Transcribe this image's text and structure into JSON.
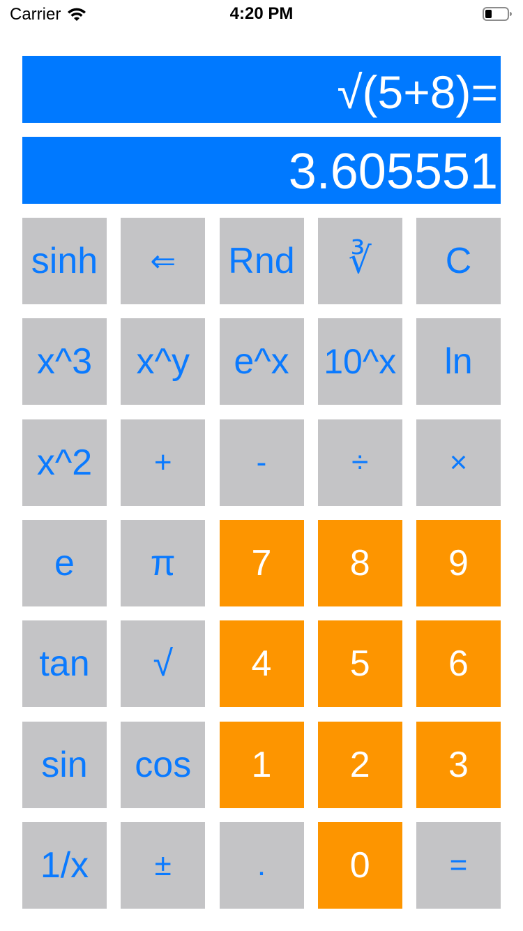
{
  "status_bar": {
    "carrier": "Carrier",
    "time": "4:20 PM"
  },
  "display": {
    "expression": "√(5+8)=",
    "result": "3.605551"
  },
  "colors": {
    "display_bg": "#0079ff",
    "function_key_bg": "#c4c4c6",
    "function_key_text": "#0a7aff",
    "digit_key_bg": "#fd9500",
    "digit_key_text": "#ffffff"
  },
  "keys": [
    {
      "label": "sinh",
      "type": "function"
    },
    {
      "label": "⇐",
      "type": "function"
    },
    {
      "label": "Rnd",
      "type": "function"
    },
    {
      "label": "∛",
      "type": "function"
    },
    {
      "label": "C",
      "type": "function"
    },
    {
      "label": "x^3",
      "type": "function"
    },
    {
      "label": "x^y",
      "type": "function"
    },
    {
      "label": "e^x",
      "type": "function"
    },
    {
      "label": "10^x",
      "type": "function"
    },
    {
      "label": "ln",
      "type": "function"
    },
    {
      "label": "x^2",
      "type": "function"
    },
    {
      "label": "+",
      "type": "function"
    },
    {
      "label": "-",
      "type": "function"
    },
    {
      "label": "÷",
      "type": "function"
    },
    {
      "label": "×",
      "type": "function"
    },
    {
      "label": "e",
      "type": "function"
    },
    {
      "label": "π",
      "type": "function"
    },
    {
      "label": "7",
      "type": "digit"
    },
    {
      "label": "8",
      "type": "digit"
    },
    {
      "label": "9",
      "type": "digit"
    },
    {
      "label": "tan",
      "type": "function"
    },
    {
      "label": "√",
      "type": "function"
    },
    {
      "label": "4",
      "type": "digit"
    },
    {
      "label": "5",
      "type": "digit"
    },
    {
      "label": "6",
      "type": "digit"
    },
    {
      "label": "sin",
      "type": "function"
    },
    {
      "label": "cos",
      "type": "function"
    },
    {
      "label": "1",
      "type": "digit"
    },
    {
      "label": "2",
      "type": "digit"
    },
    {
      "label": "3",
      "type": "digit"
    },
    {
      "label": "1/x",
      "type": "function"
    },
    {
      "label": "±",
      "type": "function"
    },
    {
      "label": ".",
      "type": "function"
    },
    {
      "label": "0",
      "type": "digit"
    },
    {
      "label": "=",
      "type": "function"
    }
  ]
}
